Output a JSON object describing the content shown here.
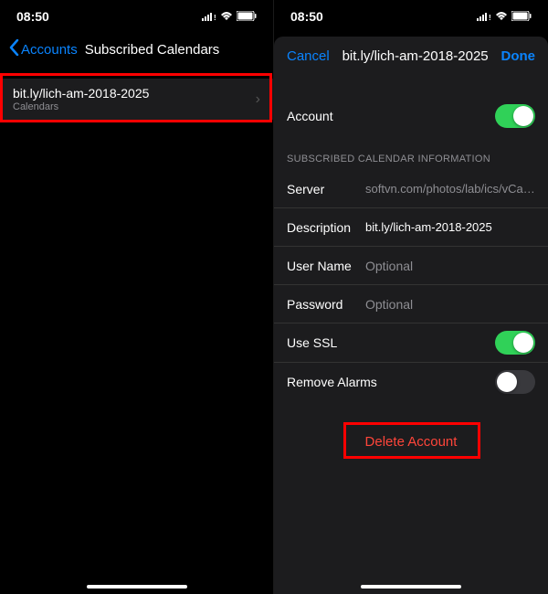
{
  "status": {
    "time": "08:50"
  },
  "left": {
    "back": "Accounts",
    "title": "Subscribed Calendars",
    "item": {
      "title": "bit.ly/lich-am-2018-2025",
      "sub": "Calendars"
    }
  },
  "right": {
    "cancel": "Cancel",
    "title": "bit.ly/lich-am-2018-2025",
    "done": "Done",
    "accountLabel": "Account",
    "sectionHeader": "Subscribed Calendar Information",
    "serverLabel": "Server",
    "serverValue": "softvn.com/photos/lab/ics/vCalender_201...",
    "descLabel": "Description",
    "descValue": "bit.ly/lich-am-2018-2025",
    "userLabel": "User Name",
    "userPlaceholder": "Optional",
    "passLabel": "Password",
    "passPlaceholder": "Optional",
    "sslLabel": "Use SSL",
    "alarmsLabel": "Remove Alarms",
    "delete": "Delete Account"
  }
}
